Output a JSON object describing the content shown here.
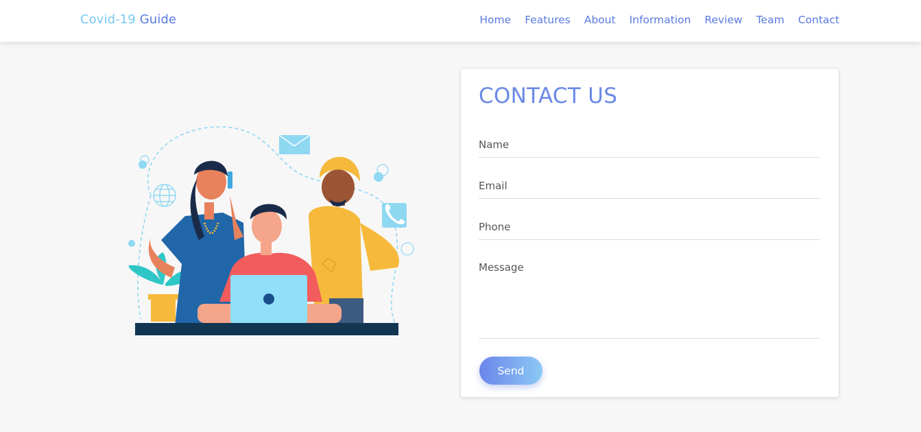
{
  "navbar": {
    "brand_part1": "Covid-19",
    "brand_part2": "Guide",
    "links": [
      "Home",
      "Features",
      "About",
      "Information",
      "Review",
      "Team",
      "Contact"
    ]
  },
  "contact": {
    "title": "CONTACT US",
    "name_placeholder": "Name",
    "email_placeholder": "Email",
    "phone_placeholder": "Phone",
    "message_placeholder": "Message",
    "send_label": "Send"
  },
  "colors": {
    "brand_light": "#78c8f5",
    "brand_dark": "#5a7ae0",
    "title": "#6a89e6",
    "background": "#f7f7f7"
  }
}
